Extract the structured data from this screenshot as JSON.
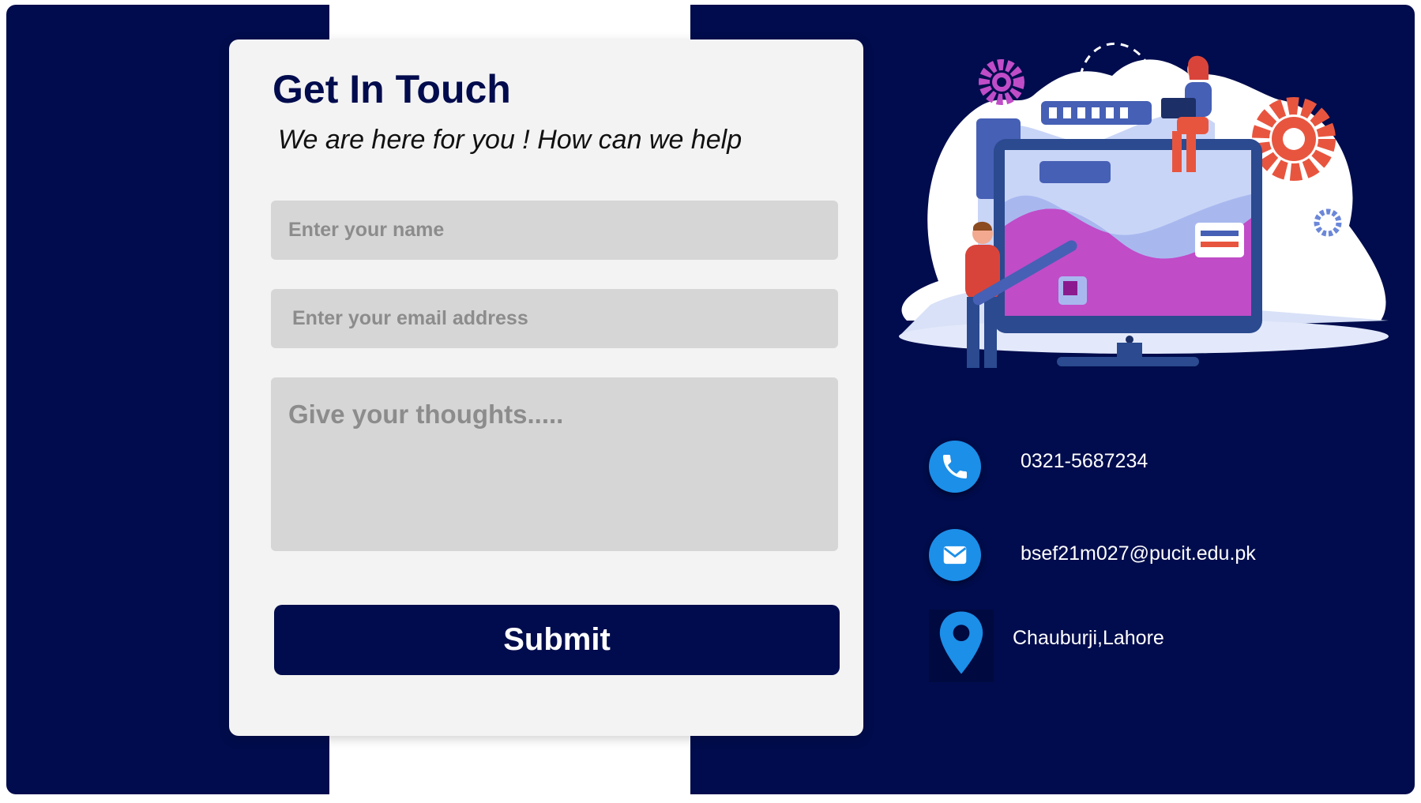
{
  "form": {
    "title": "Get In Touch",
    "subtitle": "We are here for you ! How can we help",
    "name_placeholder": "Enter your name",
    "email_placeholder": "Enter your email address",
    "thoughts_placeholder": "Give your thoughts.....",
    "submit_label": "Submit"
  },
  "contact": {
    "phone": "0321-5687234",
    "email": "bsef21m027@pucit.edu.pk",
    "location": "Chauburji,Lahore"
  },
  "icons": {
    "phone": "phone-icon",
    "email": "envelope-icon",
    "location": "map-pin-icon"
  },
  "colors": {
    "navy": "#000c4d",
    "card": "#f3f3f3",
    "field": "#d6d6d6",
    "icon_blue": "#1c8fe8"
  }
}
